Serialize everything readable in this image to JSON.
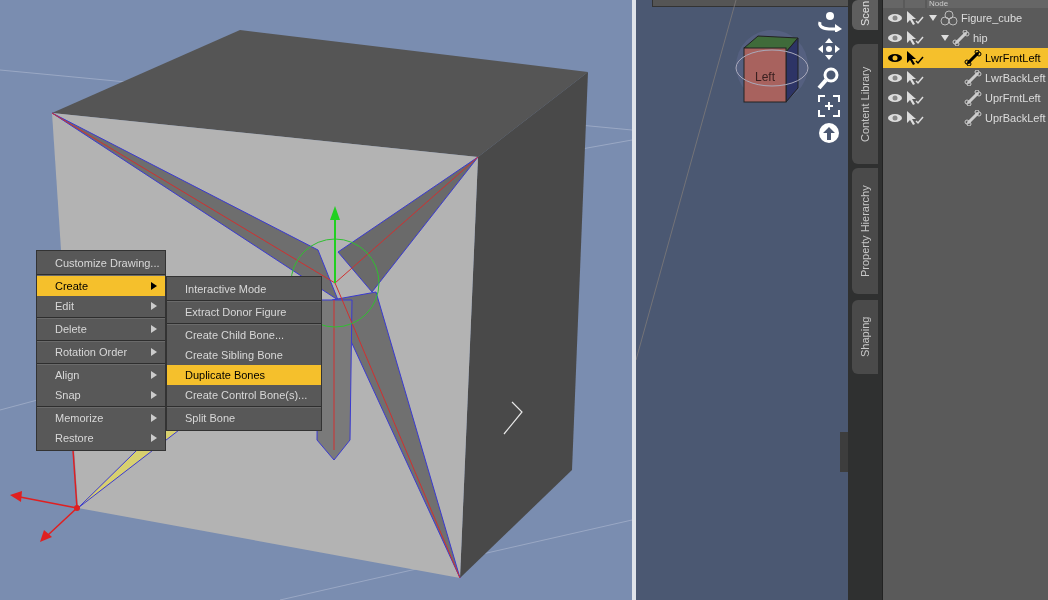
{
  "viewport": {
    "context_menu": [
      {
        "label": "Customize Drawing...",
        "submenu": false,
        "selected": false,
        "separator_after": true
      },
      {
        "label": "Create",
        "submenu": true,
        "selected": true,
        "separator_after": false
      },
      {
        "label": "Edit",
        "submenu": true,
        "selected": false,
        "separator_after": true
      },
      {
        "label": "Delete",
        "submenu": true,
        "selected": false,
        "separator_after": true
      },
      {
        "label": "Rotation Order",
        "submenu": true,
        "selected": false,
        "separator_after": true
      },
      {
        "label": "Align",
        "submenu": true,
        "selected": false,
        "separator_after": false
      },
      {
        "label": "Snap",
        "submenu": true,
        "selected": false,
        "separator_after": true
      },
      {
        "label": "Memorize",
        "submenu": true,
        "selected": false,
        "separator_after": false
      },
      {
        "label": "Restore",
        "submenu": true,
        "selected": false,
        "separator_after": false
      }
    ],
    "submenu": [
      {
        "label": "Interactive Mode",
        "selected": false,
        "separator_after": true
      },
      {
        "label": "Extract Donor Figure",
        "selected": false,
        "separator_after": true
      },
      {
        "label": "Create Child Bone...",
        "selected": false,
        "separator_after": false
      },
      {
        "label": "Create Sibling Bone",
        "selected": false,
        "separator_after": false
      },
      {
        "label": "Duplicate Bones",
        "selected": true,
        "separator_after": false
      },
      {
        "label": "Create Control Bone(s)...",
        "selected": false,
        "separator_after": true
      },
      {
        "label": "Split Bone",
        "selected": false,
        "separator_after": false
      }
    ]
  },
  "view_cube": {
    "face_label": "Left"
  },
  "side_tabs": [
    {
      "label": "Scen",
      "selected": true
    },
    {
      "label": "Content Library",
      "selected": false
    },
    {
      "label": "Property Hierarchy",
      "selected": false
    },
    {
      "label": "Shaping",
      "selected": false
    }
  ],
  "scene_tree": {
    "header": "Node",
    "nodes": [
      {
        "label": "Figure_cube",
        "kind": "figure",
        "expanded": true,
        "selected": false,
        "children": [
          {
            "label": "hip",
            "kind": "bone",
            "expanded": true,
            "selected": false,
            "children": [
              {
                "label": "LwrFrntLeft",
                "kind": "bone",
                "selected": true
              },
              {
                "label": "LwrBackLeft",
                "kind": "bone",
                "selected": false
              },
              {
                "label": "UprFrntLeft",
                "kind": "bone",
                "selected": false
              },
              {
                "label": "UprBackLeft",
                "kind": "bone",
                "selected": false
              }
            ]
          }
        ]
      }
    ]
  }
}
